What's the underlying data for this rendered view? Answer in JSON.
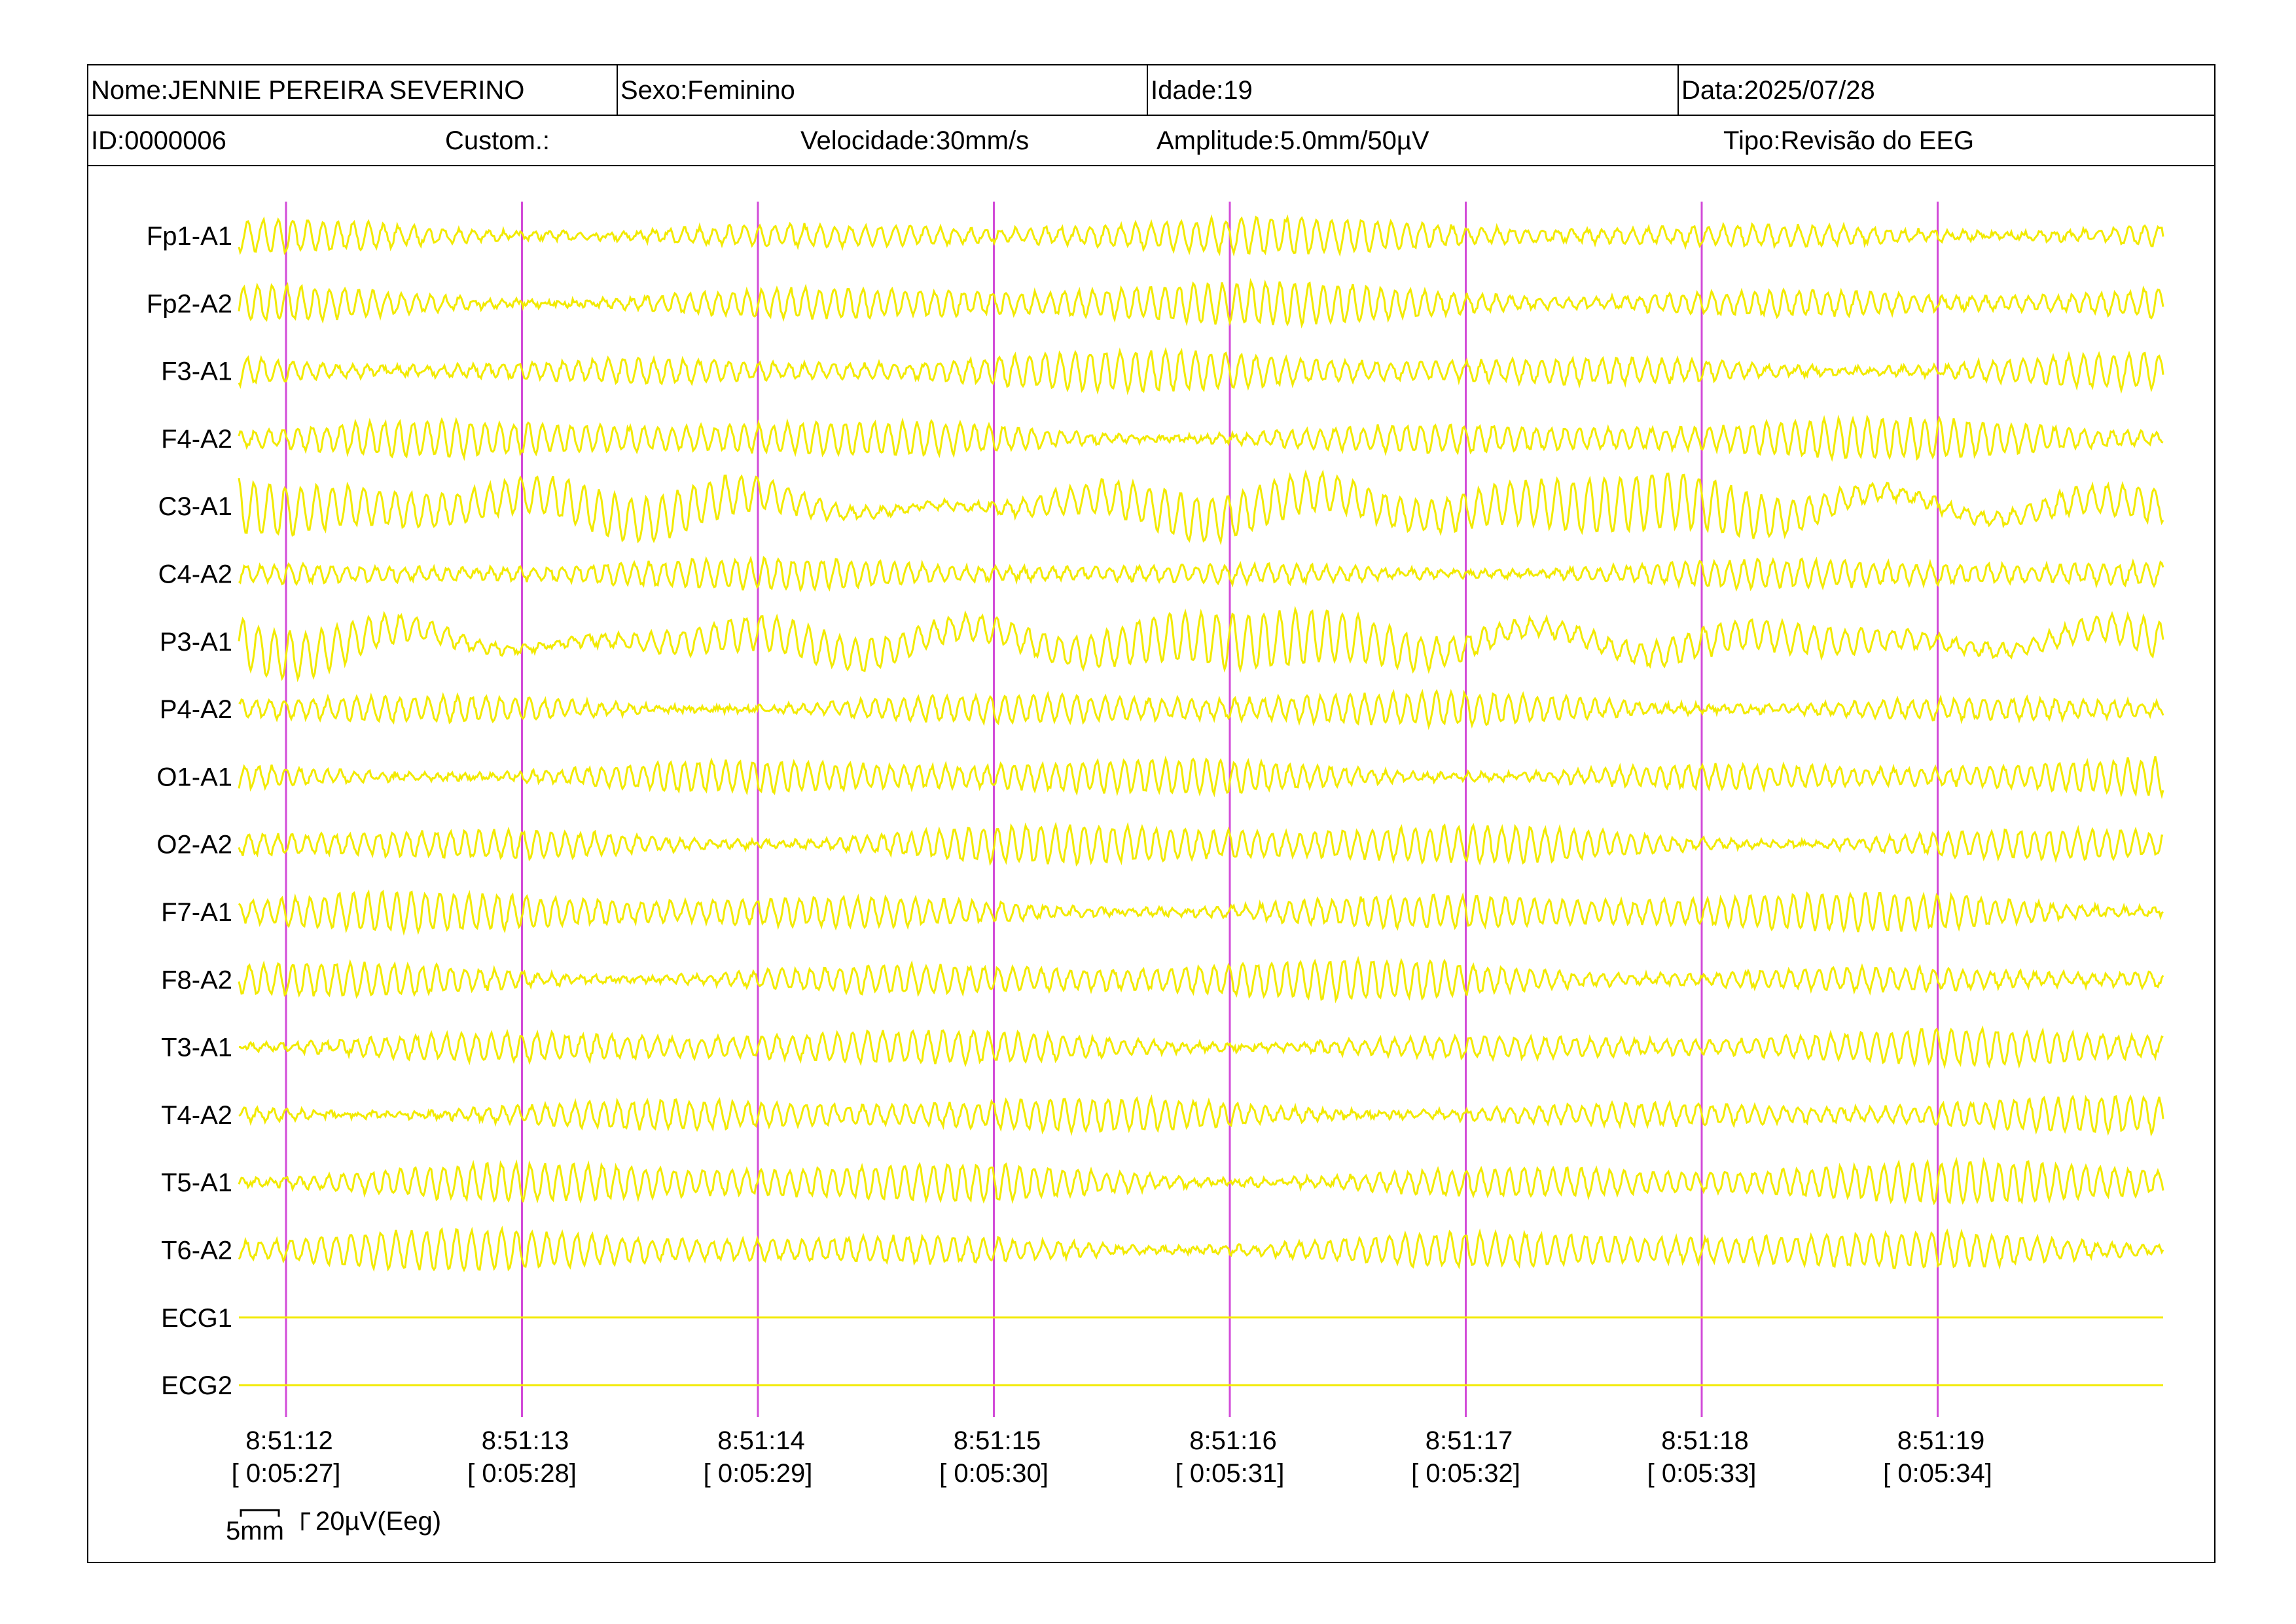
{
  "header": {
    "name": "Nome:JENNIE PEREIRA SEVERINO",
    "sex": "Sexo:Feminino",
    "age": "Idade:19",
    "date": "Data:2025/07/28",
    "id": "ID:0000006",
    "custom": "Custom.:",
    "speed": "Velocidade:30mm/s",
    "amplitude": "Amplitude:5.0mm/50µV",
    "type": "Tipo:Revisão do EEG"
  },
  "channels": [
    "Fp1-A1",
    "Fp2-A2",
    "F3-A1",
    "F4-A2",
    "C3-A1",
    "C4-A2",
    "P3-A1",
    "P4-A2",
    "O1-A1",
    "O2-A2",
    "F7-A1",
    "F8-A2",
    "T3-A1",
    "T4-A2",
    "T5-A1",
    "T6-A2",
    "ECG1",
    "ECG2"
  ],
  "time_marks": [
    {
      "clock": "8:51:12",
      "elapsed": "[ 0:05:27]"
    },
    {
      "clock": "8:51:13",
      "elapsed": "[ 0:05:28]"
    },
    {
      "clock": "8:51:14",
      "elapsed": "[ 0:05:29]"
    },
    {
      "clock": "8:51:15",
      "elapsed": "[ 0:05:30]"
    },
    {
      "clock": "8:51:16",
      "elapsed": "[ 0:05:31]"
    },
    {
      "clock": "8:51:17",
      "elapsed": "[ 0:05:32]"
    },
    {
      "clock": "8:51:18",
      "elapsed": "[ 0:05:33]"
    },
    {
      "clock": "8:51:19",
      "elapsed": "[ 0:05:34]"
    }
  ],
  "scale": {
    "time": "5mm",
    "amplitude": "20µV(Eeg)"
  },
  "colors": {
    "trace": "#F2EA00",
    "marker": "#D24BD8",
    "border": "#000000"
  }
}
